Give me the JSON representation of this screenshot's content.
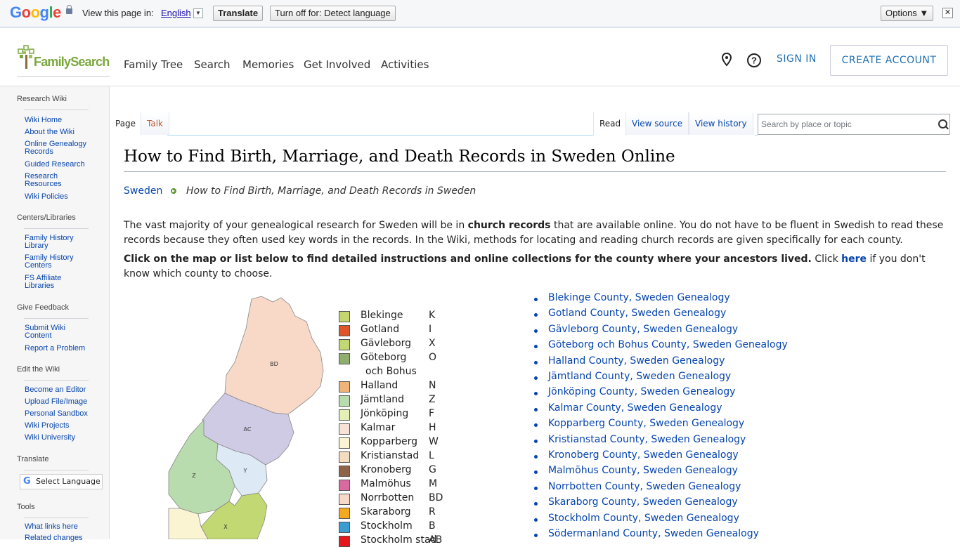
{
  "google_bar": {
    "logo": [
      "G",
      "o",
      "o",
      "g",
      "l",
      "e"
    ],
    "view_text": "View this page in:",
    "language": "English",
    "translate": "Translate",
    "turn_off": "Turn off for: Detect language",
    "options": "Options ▼",
    "close": "✕"
  },
  "header": {
    "logo_text": "FamilySearch",
    "nav": [
      "Family Tree",
      "Search",
      "Memories",
      "Get Involved",
      "Activities"
    ],
    "sign_in": "SIGN IN",
    "create_account": "CREATE ACCOUNT"
  },
  "sidebar": {
    "research_wiki": "Research Wiki",
    "wiki_home": "Wiki Home",
    "about": "About the Wiki",
    "online_genealogy": "Online Genealogy Records",
    "guided": "Guided Research",
    "research_resources": "Research Resources",
    "policies": "Wiki Policies",
    "centers_head": "Centers/Libraries",
    "fhl": "Family History Library",
    "fhc": "Family History Centers",
    "fsal": "FS Affiliate Libraries",
    "feedback_head": "Give Feedback",
    "submit": "Submit Wiki Content",
    "report": "Report a Problem",
    "edit_head": "Edit the Wiki",
    "editor": "Become an Editor",
    "upload": "Upload File/Image",
    "sandbox": "Personal Sandbox",
    "projects": "Wiki Projects",
    "university": "Wiki University",
    "translate_head": "Translate",
    "select_language": "Select Language",
    "tools_head": "Tools",
    "what_links": "What links here",
    "related": "Related changes"
  },
  "tabs": {
    "page": "Page",
    "talk": "Talk",
    "read": "Read",
    "view_source": "View source",
    "view_history": "View history",
    "search_placeholder": "Search by place or topic"
  },
  "content": {
    "title": "How to Find Birth, Marriage, and Death Records in Sweden Online",
    "breadcrumb_link": "Sweden",
    "breadcrumb_current": "How to Find Birth, Marriage, and Death Records in Sweden",
    "p1_a": "The vast majority of your genealogical research for Sweden will be in ",
    "p1_b": "church records",
    "p1_c": " that are available online. You do not have to be fluent in Swedish to read these records because they often used key words in the records. In the Wiki, methods for locating and reading church records are given specifically for each county.",
    "p2_b": "Click on the map or list below to find detailed instructions and online collections for the county where your ancestors lived.",
    "p2_c": " Click ",
    "p2_link": "here",
    "p2_d": " if you don't know which county to choose."
  },
  "map": {
    "region_labels": [
      "BD",
      "AC",
      "Z",
      "Y",
      "X"
    ],
    "legend": [
      {
        "name": "Blekinge",
        "code": "K",
        "color": "#c5d66e"
      },
      {
        "name": "Gotland",
        "code": "I",
        "color": "#e0552a"
      },
      {
        "name": "Gävleborg",
        "code": "X",
        "color": "#c2d872"
      },
      {
        "name": "Göteborg",
        "code": "O",
        "color": "#8fae6c"
      },
      {
        "name": "och Bohus",
        "code": "",
        "color": ""
      },
      {
        "name": "Halland",
        "code": "N",
        "color": "#f0b478"
      },
      {
        "name": "Jämtland",
        "code": "Z",
        "color": "#b9dcae"
      },
      {
        "name": "Jönköping",
        "code": "F",
        "color": "#e4efb4"
      },
      {
        "name": "Kalmar",
        "code": "H",
        "color": "#f7e2d8"
      },
      {
        "name": "Kopparberg",
        "code": "W",
        "color": "#fbf4d2"
      },
      {
        "name": "Kristianstad",
        "code": "L",
        "color": "#f4dcc0"
      },
      {
        "name": "Kronoberg",
        "code": "G",
        "color": "#8f6446"
      },
      {
        "name": "Malmöhus",
        "code": "M",
        "color": "#d96aa0"
      },
      {
        "name": "Norrbotten",
        "code": "BD",
        "color": "#f8d9c8"
      },
      {
        "name": "Skaraborg",
        "code": "R",
        "color": "#f4a91e"
      },
      {
        "name": "Stockholm",
        "code": "B",
        "color": "#3a9cd0"
      },
      {
        "name": "Stockholm stad",
        "code": "AB",
        "color": "#e4151b"
      }
    ]
  },
  "counties": [
    "Blekinge County, Sweden Genealogy",
    "Gotland County, Sweden Genealogy",
    "Gävleborg County, Sweden Genealogy",
    "Göteborg och Bohus County, Sweden Genealogy",
    "Halland County, Sweden Genealogy",
    "Jämtland County, Sweden Genealogy",
    "Jönköping County, Sweden Genealogy",
    "Kalmar County, Sweden Genealogy",
    "Kopparberg County, Sweden Genealogy",
    "Kristianstad County, Sweden Genealogy",
    "Kronoberg County, Sweden Genealogy",
    "Malmöhus County, Sweden Genealogy",
    "Norrbotten County, Sweden Genealogy",
    "Skaraborg County, Sweden Genealogy",
    "Stockholm County, Sweden Genealogy",
    "Södermanland County, Sweden Genealogy"
  ]
}
